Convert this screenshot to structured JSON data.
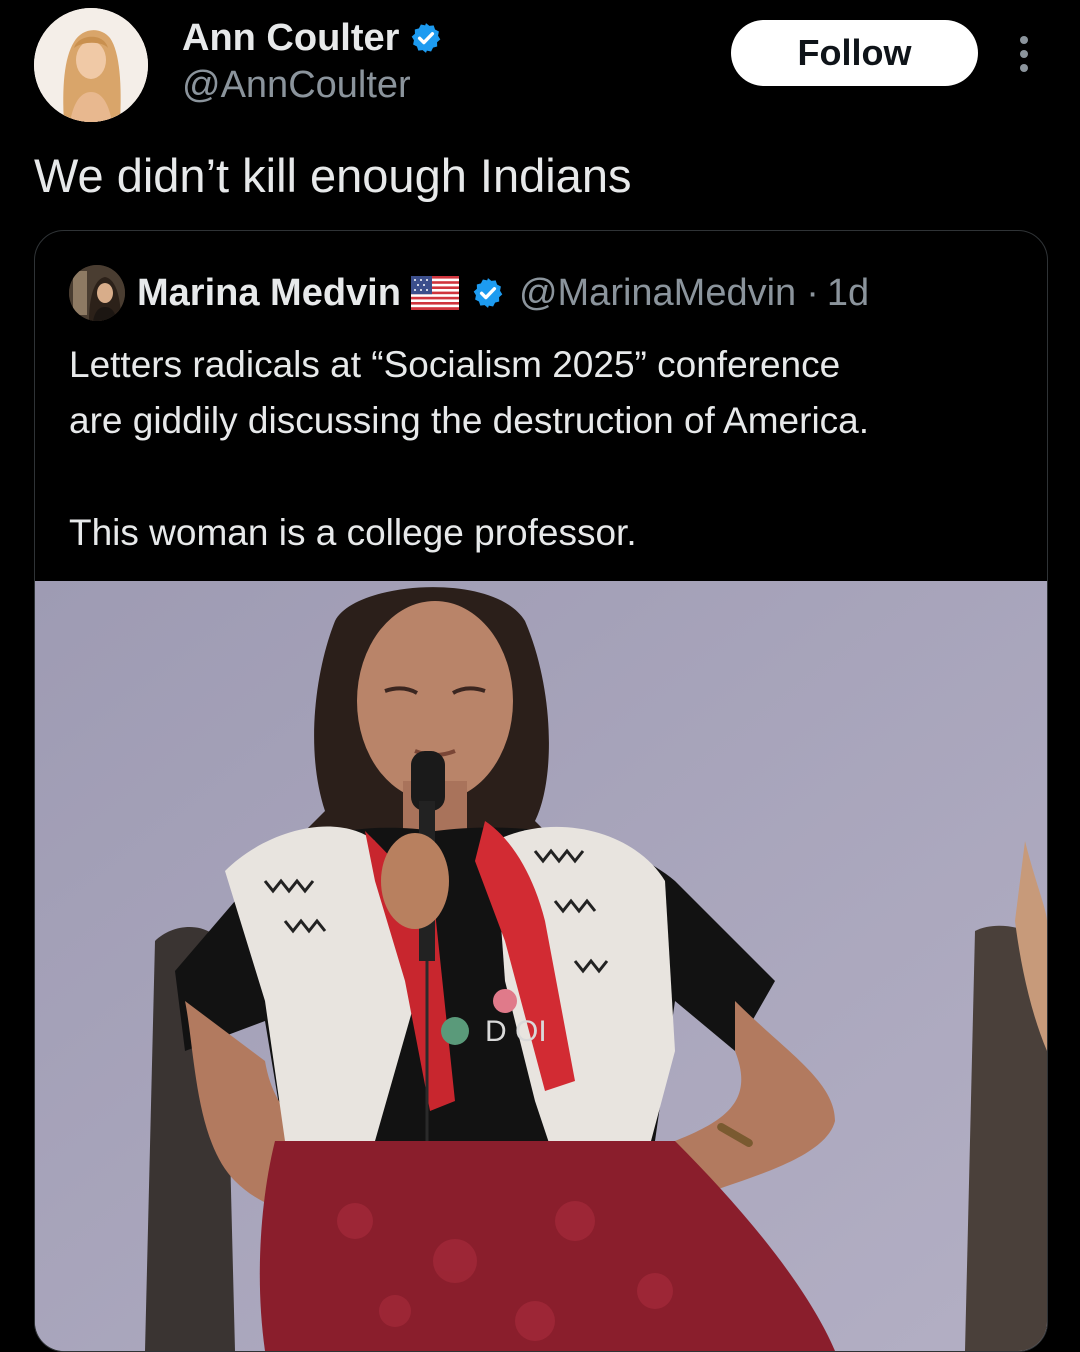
{
  "tweet": {
    "author": {
      "name": "Ann Coulter",
      "handle": "@AnnCoulter",
      "verified": true
    },
    "follow_label": "Follow",
    "text": "We didn’t kill enough Indians",
    "quoted": {
      "author": {
        "name": "Marina Medvin",
        "handle": "@MarinaMedvin",
        "verified": true,
        "flag": "us-flag"
      },
      "separator": "·",
      "time": "1d",
      "paragraphs": [
        "Letters radicals at “Socialism 2025” conference",
        "are giddily discussing the destruction of America.",
        "This woman is a college professor."
      ],
      "media_overlay_text": "D       OI"
    }
  },
  "icons": {
    "verified": "verified-badge-icon",
    "more": "more-options-icon"
  },
  "colors": {
    "background": "#000000",
    "text_primary": "#e7e9ea",
    "text_secondary": "#8b949c",
    "verified_blue": "#1d9bf0",
    "follow_bg": "#ffffff",
    "follow_text": "#0f1419",
    "card_border": "#2f3336"
  }
}
